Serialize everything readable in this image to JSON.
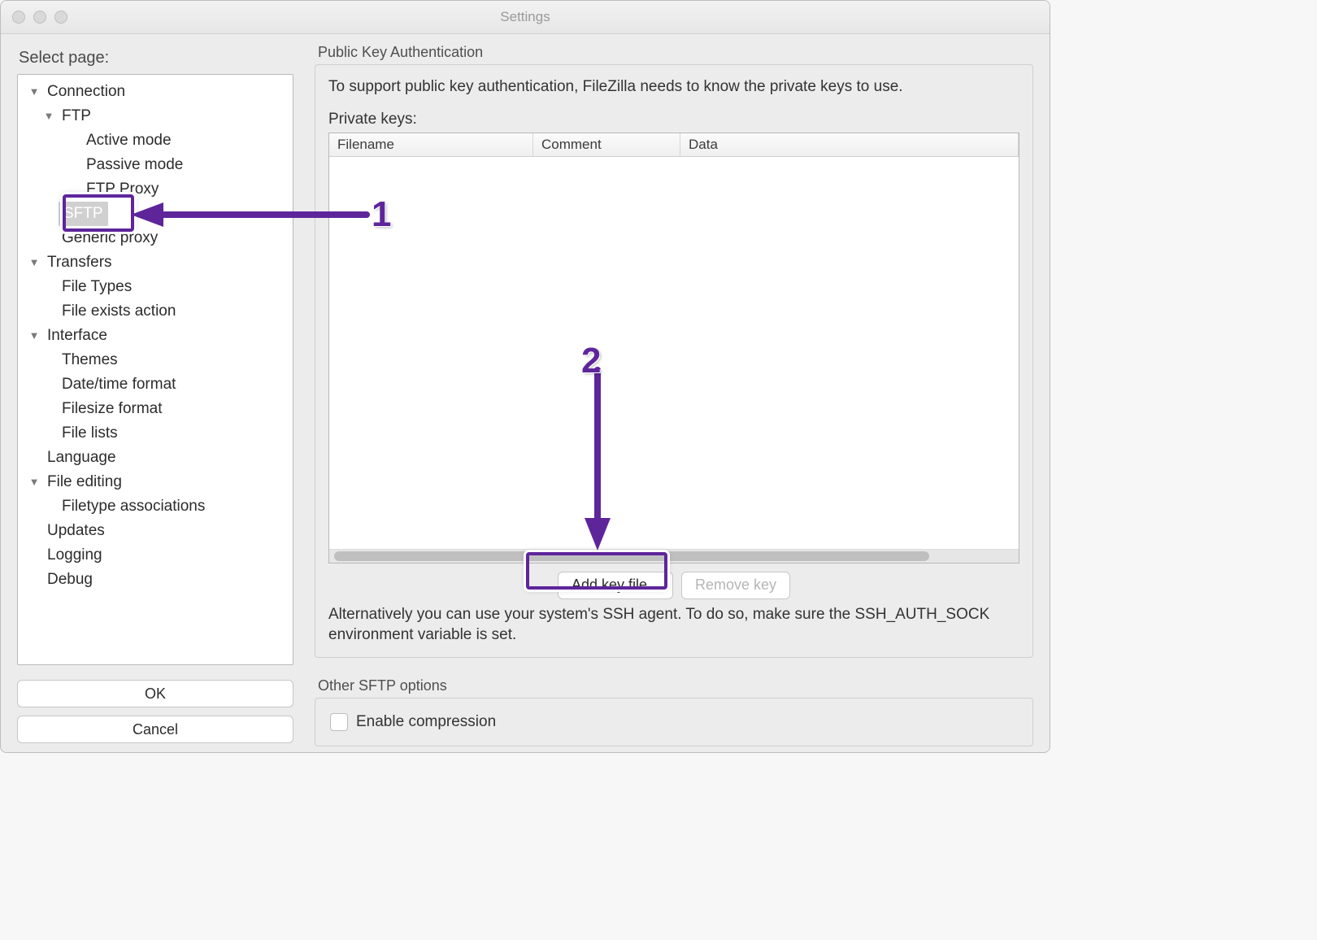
{
  "window": {
    "title": "Settings"
  },
  "sidebar": {
    "label": "Select page:",
    "tree": [
      {
        "label": "Connection",
        "level": 0,
        "expandable": true
      },
      {
        "label": "FTP",
        "level": 1,
        "expandable": true
      },
      {
        "label": "Active mode",
        "level": 2,
        "expandable": false
      },
      {
        "label": "Passive mode",
        "level": 2,
        "expandable": false
      },
      {
        "label": "FTP Proxy",
        "level": 2,
        "expandable": false
      },
      {
        "label": "SFTP",
        "level": 1,
        "expandable": false,
        "selected": true
      },
      {
        "label": "Generic proxy",
        "level": 1,
        "expandable": false
      },
      {
        "label": "Transfers",
        "level": 0,
        "expandable": true
      },
      {
        "label": "File Types",
        "level": 1,
        "expandable": false
      },
      {
        "label": "File exists action",
        "level": 1,
        "expandable": false
      },
      {
        "label": "Interface",
        "level": 0,
        "expandable": true
      },
      {
        "label": "Themes",
        "level": 1,
        "expandable": false
      },
      {
        "label": "Date/time format",
        "level": 1,
        "expandable": false
      },
      {
        "label": "Filesize format",
        "level": 1,
        "expandable": false
      },
      {
        "label": "File lists",
        "level": 1,
        "expandable": false
      },
      {
        "label": "Language",
        "level": 0,
        "expandable": false
      },
      {
        "label": "File editing",
        "level": 0,
        "expandable": true
      },
      {
        "label": "Filetype associations",
        "level": 1,
        "expandable": false
      },
      {
        "label": "Updates",
        "level": 0,
        "expandable": false
      },
      {
        "label": "Logging",
        "level": 0,
        "expandable": false
      },
      {
        "label": "Debug",
        "level": 0,
        "expandable": false
      }
    ],
    "ok_label": "OK",
    "cancel_label": "Cancel"
  },
  "main": {
    "group1_label": "Public Key Authentication",
    "description": "To support public key authentication, FileZilla needs to know the private keys to use.",
    "private_keys_label": "Private keys:",
    "columns": {
      "filename": "Filename",
      "comment": "Comment",
      "data": "Data"
    },
    "add_key_label": "Add key file...",
    "remove_key_label": "Remove key",
    "alt_note": "Alternatively you can use your system's SSH agent. To do so, make sure the SSH_AUTH_SOCK environment variable is set.",
    "group2_label": "Other SFTP options",
    "enable_compression_label": "Enable compression"
  },
  "annotations": {
    "step1": "1",
    "step2": "2"
  }
}
